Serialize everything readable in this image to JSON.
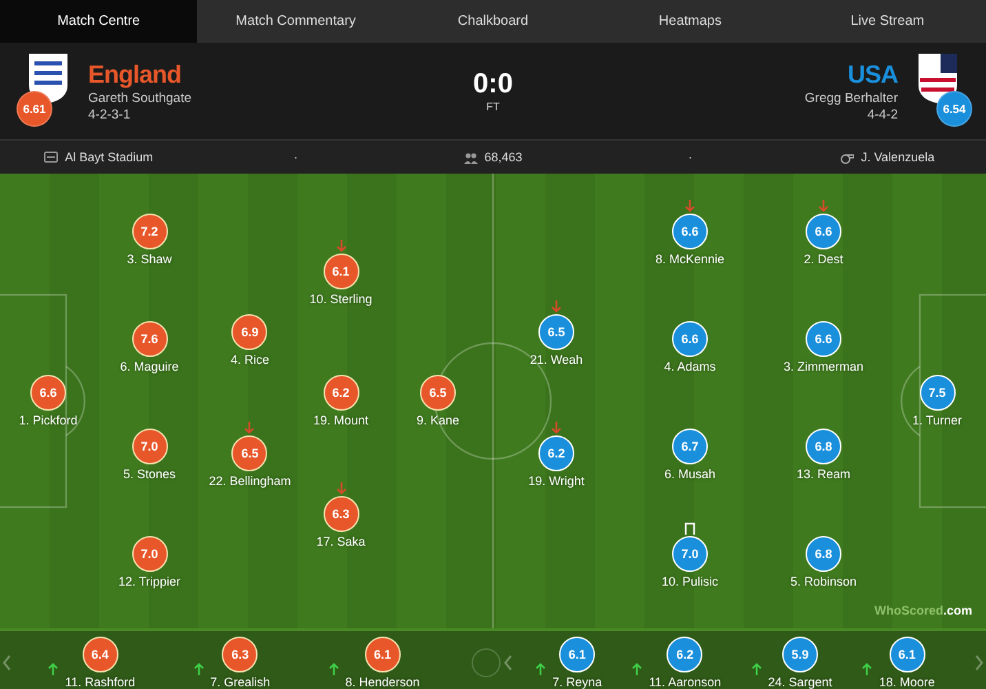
{
  "tabs": [
    {
      "label": "Match Centre",
      "selected": true
    },
    {
      "label": "Match Commentary",
      "selected": false
    },
    {
      "label": "Chalkboard",
      "selected": false
    },
    {
      "label": "Heatmaps",
      "selected": false
    },
    {
      "label": "Live Stream",
      "selected": false
    }
  ],
  "score": {
    "home": "0",
    "separator": ":",
    "away": "0",
    "status": "FT"
  },
  "teams": [
    {
      "name": "England",
      "manager": "Gareth Southgate",
      "formation": "4-2-3-1",
      "rating": "6.61",
      "color": "#e8572a",
      "lines": [
        [
          {
            "name": "1. Pickford",
            "rating": "6.6",
            "subbed_off": false,
            "flagged": false
          }
        ],
        [
          {
            "name": "3. Shaw",
            "rating": "7.2",
            "subbed_off": false,
            "flagged": false
          },
          {
            "name": "6. Maguire",
            "rating": "7.6",
            "subbed_off": false,
            "flagged": false
          },
          {
            "name": "5. Stones",
            "rating": "7.0",
            "subbed_off": false,
            "flagged": false
          },
          {
            "name": "12. Trippier",
            "rating": "7.0",
            "subbed_off": false,
            "flagged": false
          }
        ],
        [
          {
            "name": "4. Rice",
            "rating": "6.9",
            "subbed_off": false,
            "flagged": false
          },
          {
            "name": "22. Bellingham",
            "rating": "6.5",
            "subbed_off": true,
            "flagged": false
          }
        ],
        [
          {
            "name": "10. Sterling",
            "rating": "6.1",
            "subbed_off": true,
            "flagged": false
          },
          {
            "name": "19. Mount",
            "rating": "6.2",
            "subbed_off": false,
            "flagged": false
          },
          {
            "name": "17. Saka",
            "rating": "6.3",
            "subbed_off": true,
            "flagged": false
          }
        ],
        [
          {
            "name": "9. Kane",
            "rating": "6.5",
            "subbed_off": false,
            "flagged": false
          }
        ]
      ],
      "bench": [
        {
          "name": "11. Rashford",
          "rating": "6.4",
          "subbed_on": true
        },
        {
          "name": "7. Grealish",
          "rating": "6.3",
          "subbed_on": true
        },
        {
          "name": "8. Henderson",
          "rating": "6.1",
          "subbed_on": true
        }
      ]
    },
    {
      "name": "USA",
      "manager": "Gregg Berhalter",
      "formation": "4-4-2",
      "rating": "6.54",
      "color": "#1a8fdc",
      "lines": [
        [
          {
            "name": "21. Weah",
            "rating": "6.5",
            "subbed_off": true,
            "flagged": false
          },
          {
            "name": "19. Wright",
            "rating": "6.2",
            "subbed_off": true,
            "flagged": false
          }
        ],
        [
          {
            "name": "8. McKennie",
            "rating": "6.6",
            "subbed_off": true,
            "flagged": false
          },
          {
            "name": "4. Adams",
            "rating": "6.6",
            "subbed_off": false,
            "flagged": false
          },
          {
            "name": "6. Musah",
            "rating": "6.7",
            "subbed_off": false,
            "flagged": false
          },
          {
            "name": "10. Pulisic",
            "rating": "7.0",
            "subbed_off": false,
            "flagged": true
          }
        ],
        [
          {
            "name": "2. Dest",
            "rating": "6.6",
            "subbed_off": true,
            "flagged": false
          },
          {
            "name": "3. Zimmerman",
            "rating": "6.6",
            "subbed_off": false,
            "flagged": false
          },
          {
            "name": "13. Ream",
            "rating": "6.8",
            "subbed_off": false,
            "flagged": false
          },
          {
            "name": "5. Robinson",
            "rating": "6.8",
            "subbed_off": false,
            "flagged": false
          }
        ],
        [
          {
            "name": "1. Turner",
            "rating": "7.5",
            "subbed_off": false,
            "flagged": false
          }
        ]
      ],
      "bench": [
        {
          "name": "7. Reyna",
          "rating": "6.1",
          "subbed_on": true
        },
        {
          "name": "11. Aaronson",
          "rating": "6.2",
          "subbed_on": true
        },
        {
          "name": "24. Sargent",
          "rating": "5.9",
          "subbed_on": true
        },
        {
          "name": "18. Moore",
          "rating": "6.1",
          "subbed_on": true
        }
      ]
    }
  ],
  "info": {
    "stadium": "Al Bayt Stadium",
    "separator_1": "·",
    "attendance": "68,463",
    "separator_2": "·",
    "referee": "J. Valenzuela"
  },
  "logo": {
    "brand": "WhoScored",
    "suffix": ".com"
  }
}
